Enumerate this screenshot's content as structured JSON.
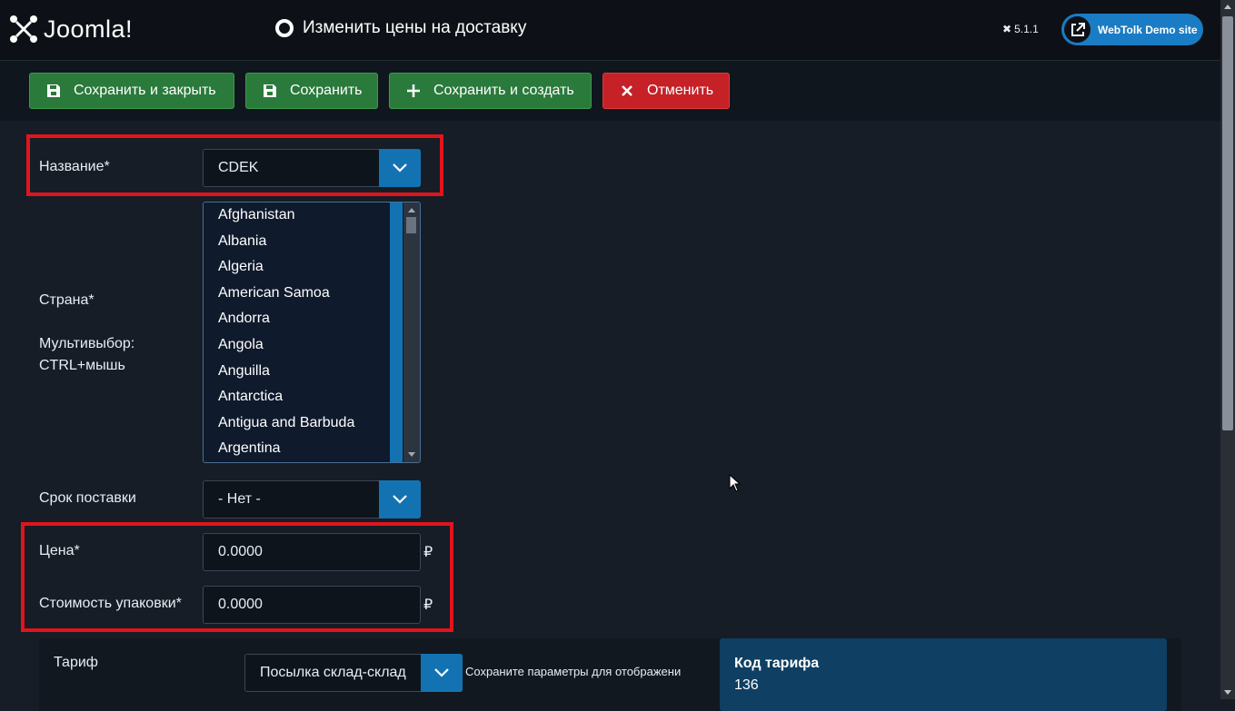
{
  "header": {
    "logo_text": "Joomla!",
    "page_title": "Изменить цены на доставку",
    "version": "5.1.1",
    "site_button_label": "WebTolk Demo site"
  },
  "toolbar": {
    "save_close": "Сохранить и закрыть",
    "save": "Сохранить",
    "save_new": "Сохранить и создать",
    "cancel": "Отменить"
  },
  "form": {
    "name_label": "Название*",
    "name_value": "CDEK",
    "country_label": "Страна*",
    "multiselect_hint_line1": "Мультивыбор:",
    "multiselect_hint_line2": "CTRL+мышь",
    "countries": [
      "Afghanistan",
      "Albania",
      "Algeria",
      "American Samoa",
      "Andorra",
      "Angola",
      "Anguilla",
      "Antarctica",
      "Antigua and Barbuda",
      "Argentina"
    ],
    "delivery_time_label": "Срок поставки",
    "delivery_time_value": "- Нет -",
    "price_label": "Цена*",
    "price_value": "0.0000",
    "packaging_label": "Стоимость упаковки*",
    "packaging_value": "0.0000",
    "currency_symbol": "₽"
  },
  "tariff": {
    "label": "Тариф",
    "value": "Посылка склад-склад",
    "hint": "Сохраните параметры для отображени",
    "code_title": "Код тарифа",
    "code_value": "136"
  }
}
